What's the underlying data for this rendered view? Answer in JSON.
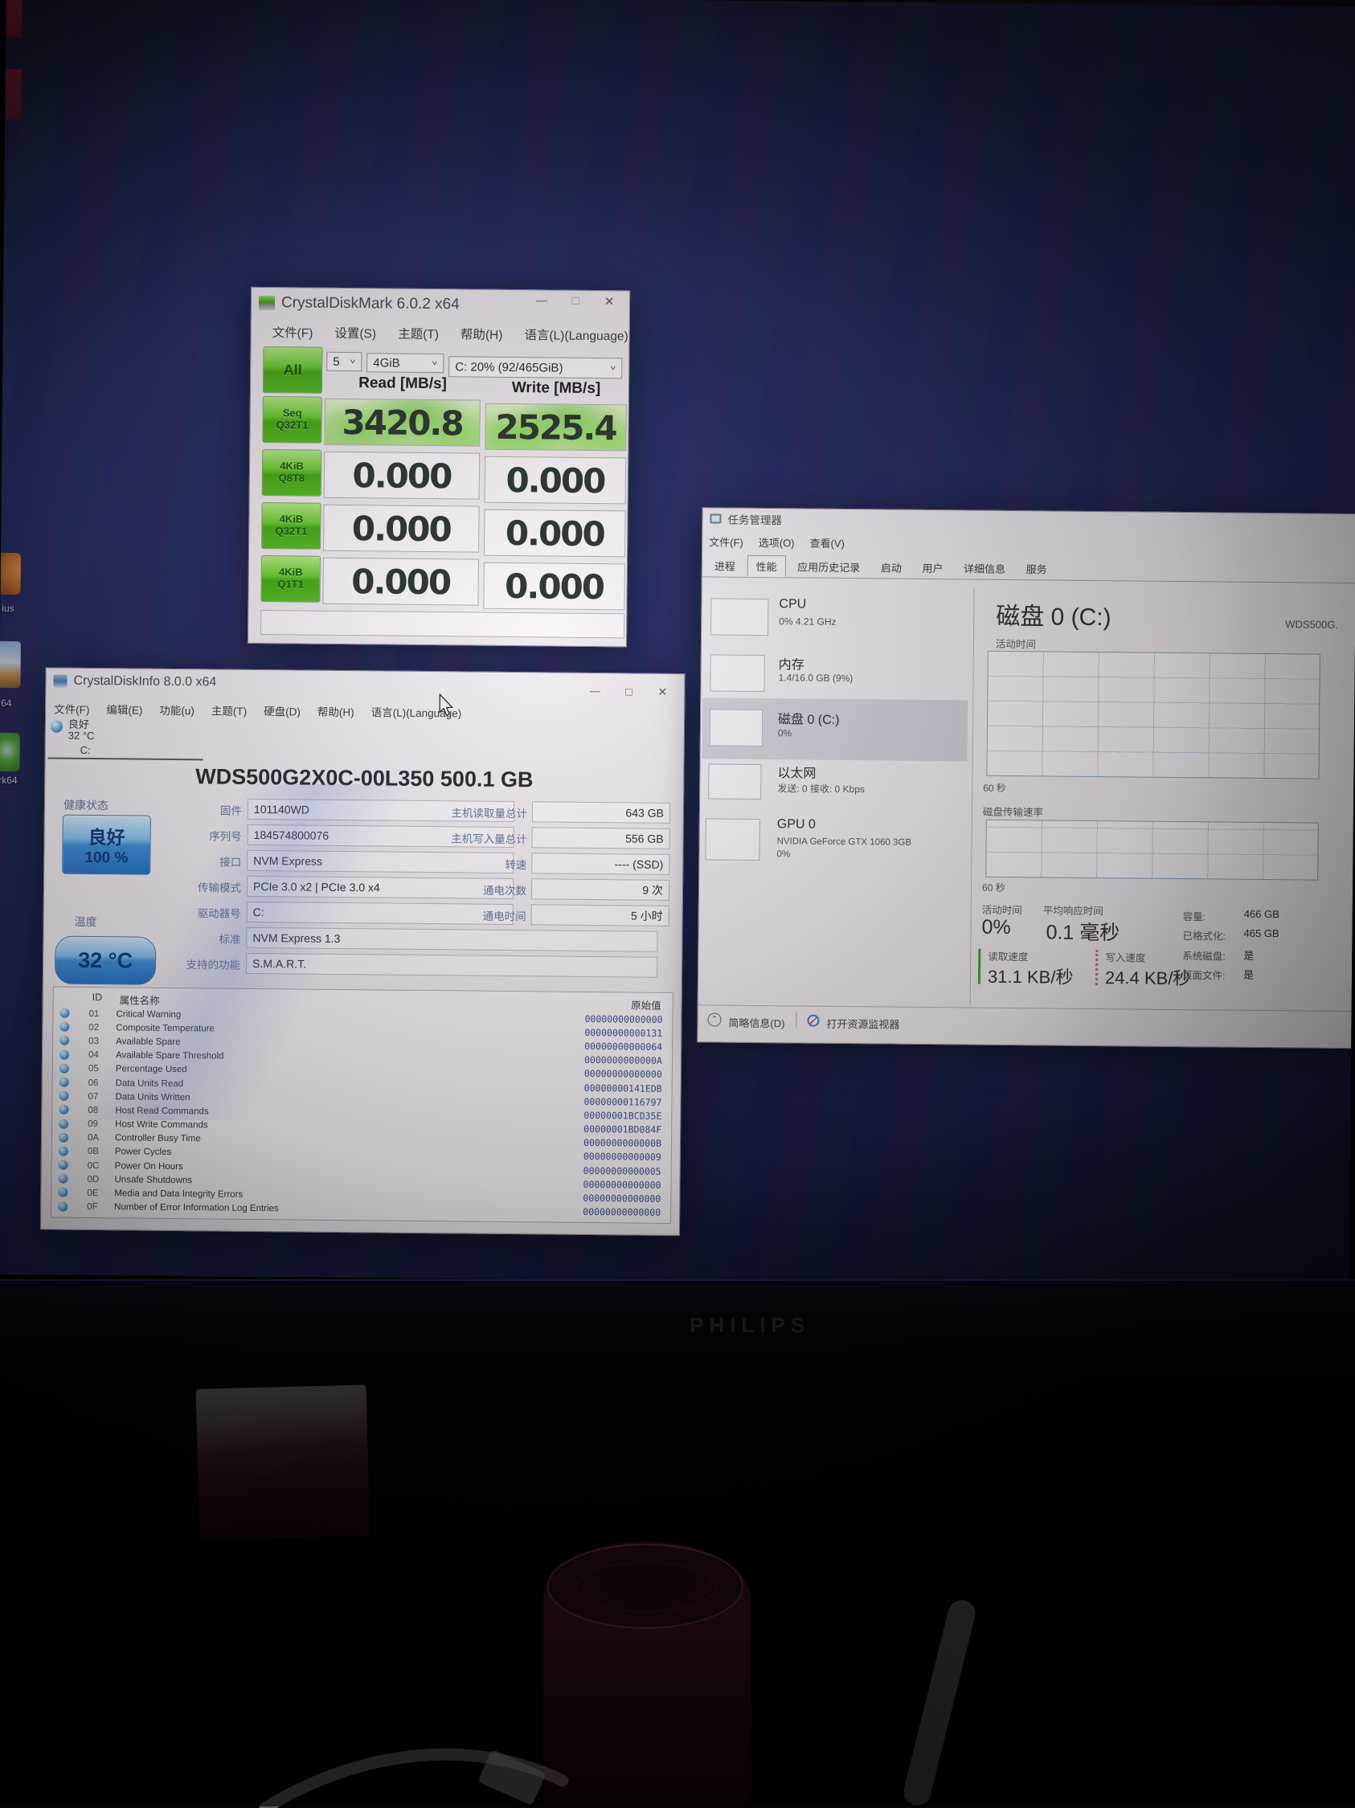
{
  "icons": {
    "minimize": "—",
    "maximize": "□",
    "close": "✕",
    "dropdown": "˅",
    "expand": "⌃"
  },
  "scene": {
    "brand": "PHILIPS"
  },
  "desktop": {
    "icon_labels": [
      "ius",
      "64",
      "rk64"
    ]
  },
  "diskmark": {
    "title": "CrystalDiskMark 6.0.2 x64",
    "menu": [
      "文件(F)",
      "设置(S)",
      "主题(T)",
      "帮助(H)",
      "语言(L)(Language)"
    ],
    "all_label": "All",
    "dropdowns": {
      "count": "5",
      "size": "4GiB",
      "target": "C: 20% (92/465GiB)"
    },
    "headers": {
      "read": "Read [MB/s]",
      "write": "Write [MB/s]"
    },
    "rows": [
      {
        "line1": "Seq",
        "line2": "Q32T1",
        "read": "3420.8",
        "write": "2525.4"
      },
      {
        "line1": "4KiB",
        "line2": "Q8T8",
        "read": "0.000",
        "write": "0.000"
      },
      {
        "line1": "4KiB",
        "line2": "Q32T1",
        "read": "0.000",
        "write": "0.000"
      },
      {
        "line1": "4KiB",
        "line2": "Q1T1",
        "read": "0.000",
        "write": "0.000"
      }
    ]
  },
  "diskinfo": {
    "title": "CrystalDiskInfo 8.0.0 x64",
    "menu": [
      "文件(F)",
      "编辑(E)",
      "功能(u)",
      "主题(T)",
      "硬盘(D)",
      "帮助(H)",
      "语言(L)(Language)"
    ],
    "drive_bar": {
      "status": "良好",
      "temperature": "32 °C",
      "drive": "C:"
    },
    "model": "WDS500G2X0C-00L350 500.1 GB",
    "health": {
      "label": "健康状态",
      "status": "良好",
      "percent": "100 %"
    },
    "temperature": {
      "label": "温度",
      "value": "32 °C"
    },
    "fields_mid": [
      {
        "label": "固件",
        "value": "101140WD"
      },
      {
        "label": "序列号",
        "value": "184574800076"
      },
      {
        "label": "接口",
        "value": "NVM Express"
      },
      {
        "label": "传输模式",
        "value": "PCIe 3.0 x2 | PCIe 3.0 x4"
      },
      {
        "label": "驱动器号",
        "value": "C:"
      },
      {
        "label": "标准",
        "value": "NVM Express 1.3"
      },
      {
        "label": "支持的功能",
        "value": "S.M.A.R.T."
      }
    ],
    "fields_right": [
      {
        "label": "主机读取量总计",
        "value": "643 GB"
      },
      {
        "label": "主机写入量总计",
        "value": "556 GB"
      },
      {
        "label": "转速",
        "value": "---- (SSD)"
      },
      {
        "label": "通电次数",
        "value": "9 次"
      },
      {
        "label": "通电时间",
        "value": "5 小时"
      }
    ],
    "smart": {
      "headers": {
        "id": "ID",
        "name": "属性名称",
        "raw": "原始值"
      },
      "rows": [
        {
          "id": "01",
          "name": "Critical Warning",
          "raw": "00000000000000"
        },
        {
          "id": "02",
          "name": "Composite Temperature",
          "raw": "00000000000131"
        },
        {
          "id": "03",
          "name": "Available Spare",
          "raw": "00000000000064"
        },
        {
          "id": "04",
          "name": "Available Spare Threshold",
          "raw": "0000000000000A"
        },
        {
          "id": "05",
          "name": "Percentage Used",
          "raw": "00000000000000"
        },
        {
          "id": "06",
          "name": "Data Units Read",
          "raw": "00000000141EDB"
        },
        {
          "id": "07",
          "name": "Data Units Written",
          "raw": "00000000116797"
        },
        {
          "id": "08",
          "name": "Host Read Commands",
          "raw": "00000001BCD35E"
        },
        {
          "id": "09",
          "name": "Host Write Commands",
          "raw": "00000001BD084F"
        },
        {
          "id": "0A",
          "name": "Controller Busy Time",
          "raw": "0000000000000B"
        },
        {
          "id": "0B",
          "name": "Power Cycles",
          "raw": "00000000000009"
        },
        {
          "id": "0C",
          "name": "Power On Hours",
          "raw": "00000000000005"
        },
        {
          "id": "0D",
          "name": "Unsafe Shutdowns",
          "raw": "00000000000000"
        },
        {
          "id": "0E",
          "name": "Media and Data Integrity Errors",
          "raw": "00000000000000"
        },
        {
          "id": "0F",
          "name": "Number of Error Information Log Entries",
          "raw": "00000000000000"
        }
      ]
    }
  },
  "taskmgr": {
    "title": "任务管理器",
    "menu": [
      "文件(F)",
      "选项(O)",
      "查看(V)"
    ],
    "tabs": [
      "进程",
      "性能",
      "应用历史记录",
      "启动",
      "用户",
      "详细信息",
      "服务"
    ],
    "sidebar": [
      {
        "title": "CPU",
        "sub": "0% 4.21 GHz"
      },
      {
        "title": "内存",
        "sub": "1.4/16.0 GB (9%)"
      },
      {
        "title": "磁盘 0 (C:)",
        "sub": "0%"
      },
      {
        "title": "以太网",
        "sub": "发送: 0 接收: 0 Kbps"
      },
      {
        "title": "GPU 0",
        "sub": "NVIDIA GeForce GTX 1060 3GB",
        "sub2": "0%"
      }
    ],
    "main": {
      "heading": "磁盘 0 (C:)",
      "device": "WDS500G.",
      "chart1_label": "活动时间",
      "chart1_x": "60 秒",
      "chart2_label": "磁盘传输速率",
      "chart2_x": "60 秒",
      "stats": [
        {
          "label": "活动时间",
          "value": "0%"
        },
        {
          "label": "平均响应时间",
          "value": "0.1 毫秒"
        },
        {
          "label": "读取速度",
          "value": "31.1 KB/秒"
        },
        {
          "label": "写入速度",
          "value": "24.4 KB/秒"
        }
      ],
      "props": [
        {
          "label": "容量:",
          "value": "466 GB"
        },
        {
          "label": "已格式化:",
          "value": "465 GB"
        },
        {
          "label": "系统磁盘:",
          "value": "是"
        },
        {
          "label": "页面文件:",
          "value": "是"
        }
      ]
    },
    "footer": {
      "details": "简略信息(D)",
      "resmon": "打开资源监视器"
    }
  }
}
